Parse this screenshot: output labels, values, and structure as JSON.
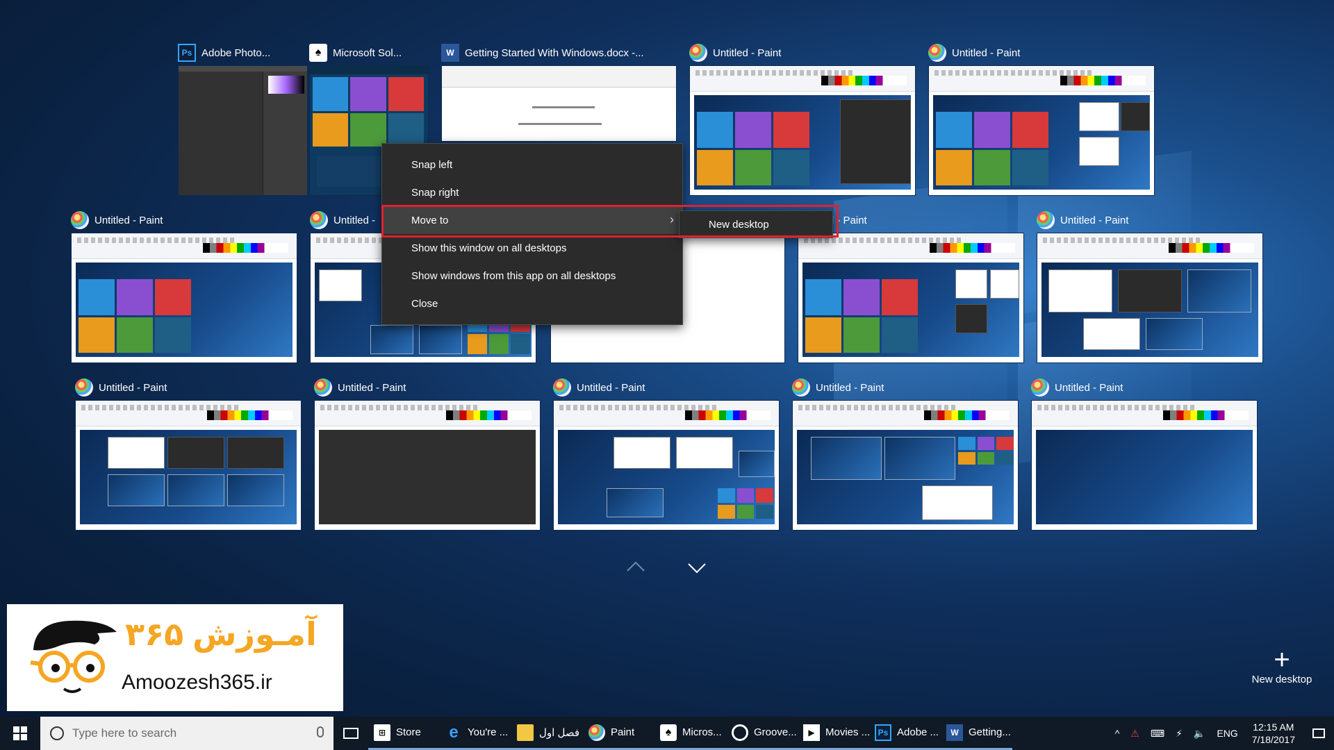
{
  "window_thumbnails": [
    {
      "title": "Adobe Photo...",
      "icon": "photoshop-icon"
    },
    {
      "title": "Microsoft Sol...",
      "icon": "solitaire-icon"
    },
    {
      "title": "Getting Started With Windows.docx -...",
      "icon": "word-icon"
    },
    {
      "title": "Untitled - Paint",
      "icon": "paint-icon"
    },
    {
      "title": "Untitled - Paint",
      "icon": "paint-icon"
    },
    {
      "title": "Untitled - Paint",
      "icon": "paint-icon"
    },
    {
      "title": "Untitled -",
      "icon": "paint-icon"
    },
    {
      "title": "tled - Paint",
      "icon": "paint-icon"
    },
    {
      "title": "Untitled - Paint",
      "icon": "paint-icon"
    },
    {
      "title": "Untitled - Paint",
      "icon": "paint-icon"
    },
    {
      "title": "Untitled - Paint",
      "icon": "paint-icon"
    },
    {
      "title": "Untitled - Paint",
      "icon": "paint-icon"
    },
    {
      "title": "Untitled - Paint",
      "icon": "paint-icon"
    },
    {
      "title": "Untitled - Paint",
      "icon": "paint-icon"
    }
  ],
  "context_menu": {
    "items": [
      {
        "label": "Snap left"
      },
      {
        "label": "Snap right"
      },
      {
        "label": "Move to",
        "has_submenu": true
      },
      {
        "label": "Show this window on all desktops"
      },
      {
        "label": "Show windows from this app on all desktops"
      },
      {
        "label": "Close"
      }
    ],
    "submenu": {
      "label": "New desktop"
    },
    "highlight_color": "#e2202b"
  },
  "new_desktop": {
    "label": "New desktop"
  },
  "brand": {
    "persian": "آمـوزش ۳۶۵",
    "url": "Amoozesh365.ir"
  },
  "taskbar": {
    "search_placeholder": "Type here to search",
    "apps": [
      {
        "label": "Store",
        "icon": "store-icon"
      },
      {
        "label": "You're ...",
        "icon": "edge-icon"
      },
      {
        "label": "فصل اول",
        "icon": "folder-icon"
      },
      {
        "label": "Paint",
        "icon": "paint-icon"
      },
      {
        "label": "Micros...",
        "icon": "solitaire-icon"
      },
      {
        "label": "Groove...",
        "icon": "groove-icon"
      },
      {
        "label": "Movies ...",
        "icon": "movies-icon"
      },
      {
        "label": "Adobe ...",
        "icon": "photoshop-icon"
      },
      {
        "label": "Getting...",
        "icon": "word-icon"
      }
    ],
    "tray": {
      "language": "ENG",
      "time": "12:15 AM",
      "date": "7/18/2017"
    }
  },
  "colors": {
    "taskbar": "#101a26",
    "menu_bg": "#2b2b2b",
    "accent_underline": "#7aa8d8"
  }
}
